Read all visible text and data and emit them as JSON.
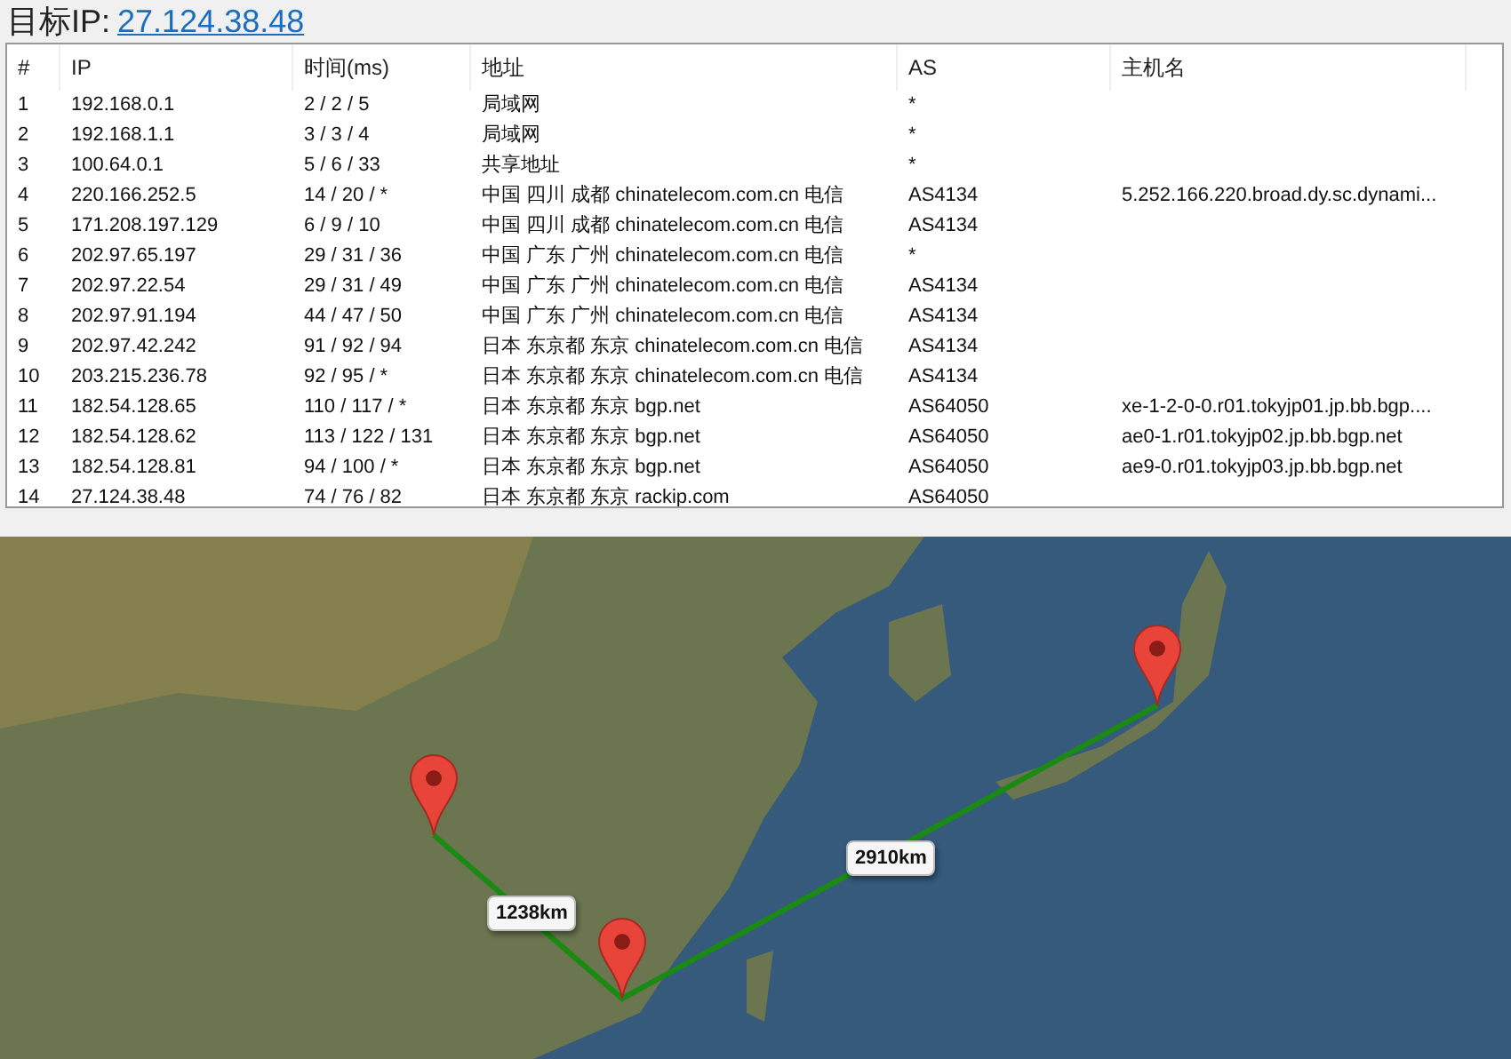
{
  "target": {
    "label": "目标IP:",
    "ip": "27.124.38.48"
  },
  "table": {
    "columns": [
      "#",
      "IP",
      "时间(ms)",
      "地址",
      "AS",
      "主机名"
    ],
    "rows": [
      [
        "1",
        "192.168.0.1",
        "2 / 2 / 5",
        "局域网",
        "*",
        ""
      ],
      [
        "2",
        "192.168.1.1",
        "3 / 3 / 4",
        "局域网",
        "*",
        ""
      ],
      [
        "3",
        "100.64.0.1",
        "5 / 6 / 33",
        "共享地址",
        "*",
        ""
      ],
      [
        "4",
        "220.166.252.5",
        "14 / 20 / *",
        "中国 四川 成都 chinatelecom.com.cn 电信",
        "AS4134",
        "5.252.166.220.broad.dy.sc.dynami..."
      ],
      [
        "5",
        "171.208.197.129",
        "6 / 9 / 10",
        "中国 四川 成都 chinatelecom.com.cn 电信",
        "AS4134",
        ""
      ],
      [
        "6",
        "202.97.65.197",
        "29 / 31 / 36",
        "中国 广东 广州 chinatelecom.com.cn 电信",
        "*",
        ""
      ],
      [
        "7",
        "202.97.22.54",
        "29 / 31 / 49",
        "中国 广东 广州 chinatelecom.com.cn 电信",
        "AS4134",
        ""
      ],
      [
        "8",
        "202.97.91.194",
        "44 / 47 / 50",
        "中国 广东 广州 chinatelecom.com.cn 电信",
        "AS4134",
        ""
      ],
      [
        "9",
        "202.97.42.242",
        "91 / 92 / 94",
        "日本 东京都 东京 chinatelecom.com.cn 电信",
        "AS4134",
        ""
      ],
      [
        "10",
        "203.215.236.78",
        "92 / 95 / *",
        "日本 东京都 东京 chinatelecom.com.cn 电信",
        "AS4134",
        ""
      ],
      [
        "11",
        "182.54.128.65",
        "110 / 117 / *",
        "日本 东京都 东京 bgp.net",
        "AS64050",
        "xe-1-2-0-0.r01.tokyjp01.jp.bb.bgp...."
      ],
      [
        "12",
        "182.54.128.62",
        "113 / 122 / 131",
        "日本 东京都 东京 bgp.net",
        "AS64050",
        "ae0-1.r01.tokyjp02.jp.bb.bgp.net"
      ],
      [
        "13",
        "182.54.128.81",
        "94 / 100 / *",
        "日本 东京都 东京 bgp.net",
        "AS64050",
        "ae9-0.r01.tokyjp03.jp.bb.bgp.net"
      ],
      [
        "14",
        "27.124.38.48",
        "74 / 76 / 82",
        "日本 东京都 东京 rackip.com",
        "AS64050",
        ""
      ]
    ]
  },
  "map": {
    "distances": [
      "1238km",
      "2910km"
    ]
  }
}
